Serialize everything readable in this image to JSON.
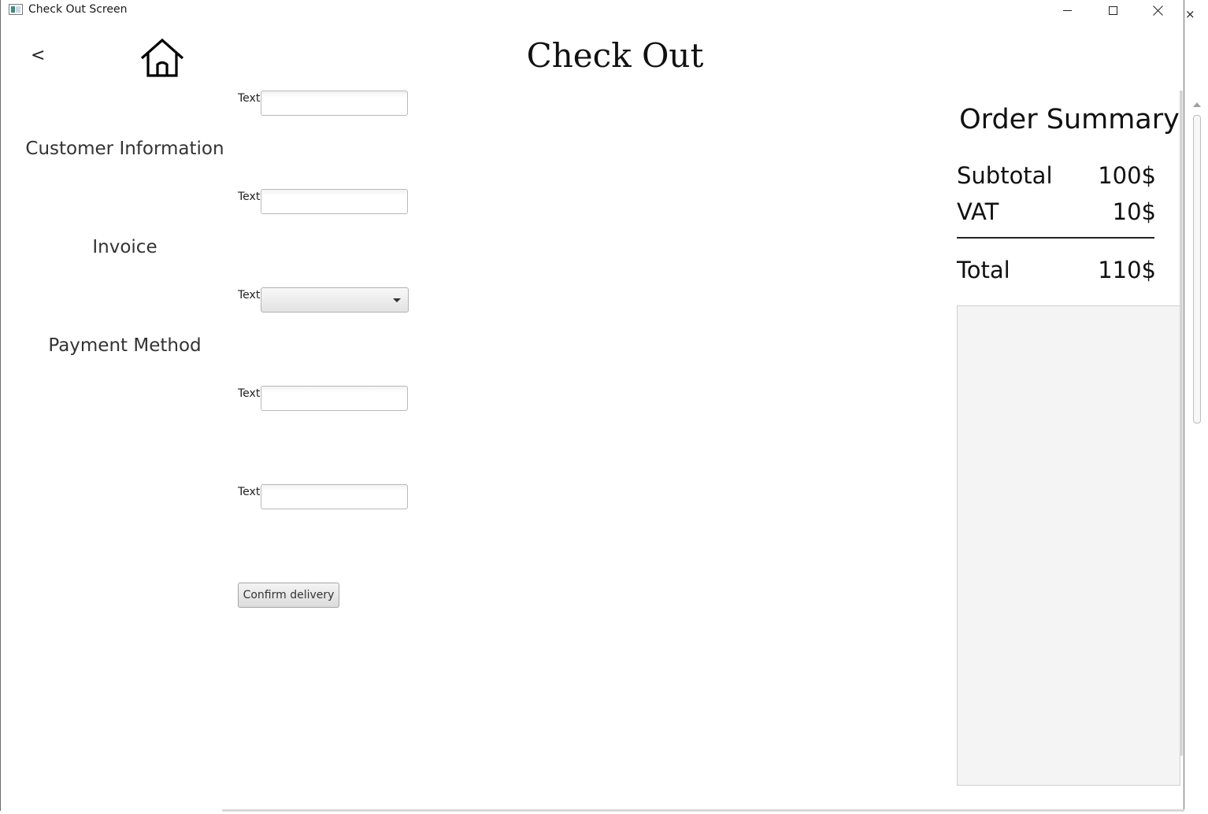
{
  "window": {
    "title": "Check Out Screen"
  },
  "header": {
    "back_label": "<",
    "home_icon": "home-icon",
    "title": "Check Out"
  },
  "sections": {
    "customer_information": "Customer Information",
    "invoice": "Invoice",
    "payment_method": "Payment Method"
  },
  "form": {
    "fields": [
      {
        "label": "Text",
        "value": "",
        "placeholder": ""
      },
      {
        "label": "Text",
        "value": "",
        "placeholder": ""
      },
      {
        "label": "Text",
        "selected": ""
      },
      {
        "label": "Text",
        "value": "",
        "placeholder": ""
      },
      {
        "label": "Text",
        "value": "",
        "placeholder": ""
      }
    ],
    "confirm_label": "Confirm delivery"
  },
  "summary": {
    "title": "Order Summary",
    "subtotal_label": "Subtotal",
    "subtotal_value": "100$",
    "vat_label": "VAT",
    "vat_value": "10$",
    "total_label": "Total",
    "total_value": "110$"
  },
  "outer_window": {
    "close_glyph": "×"
  }
}
